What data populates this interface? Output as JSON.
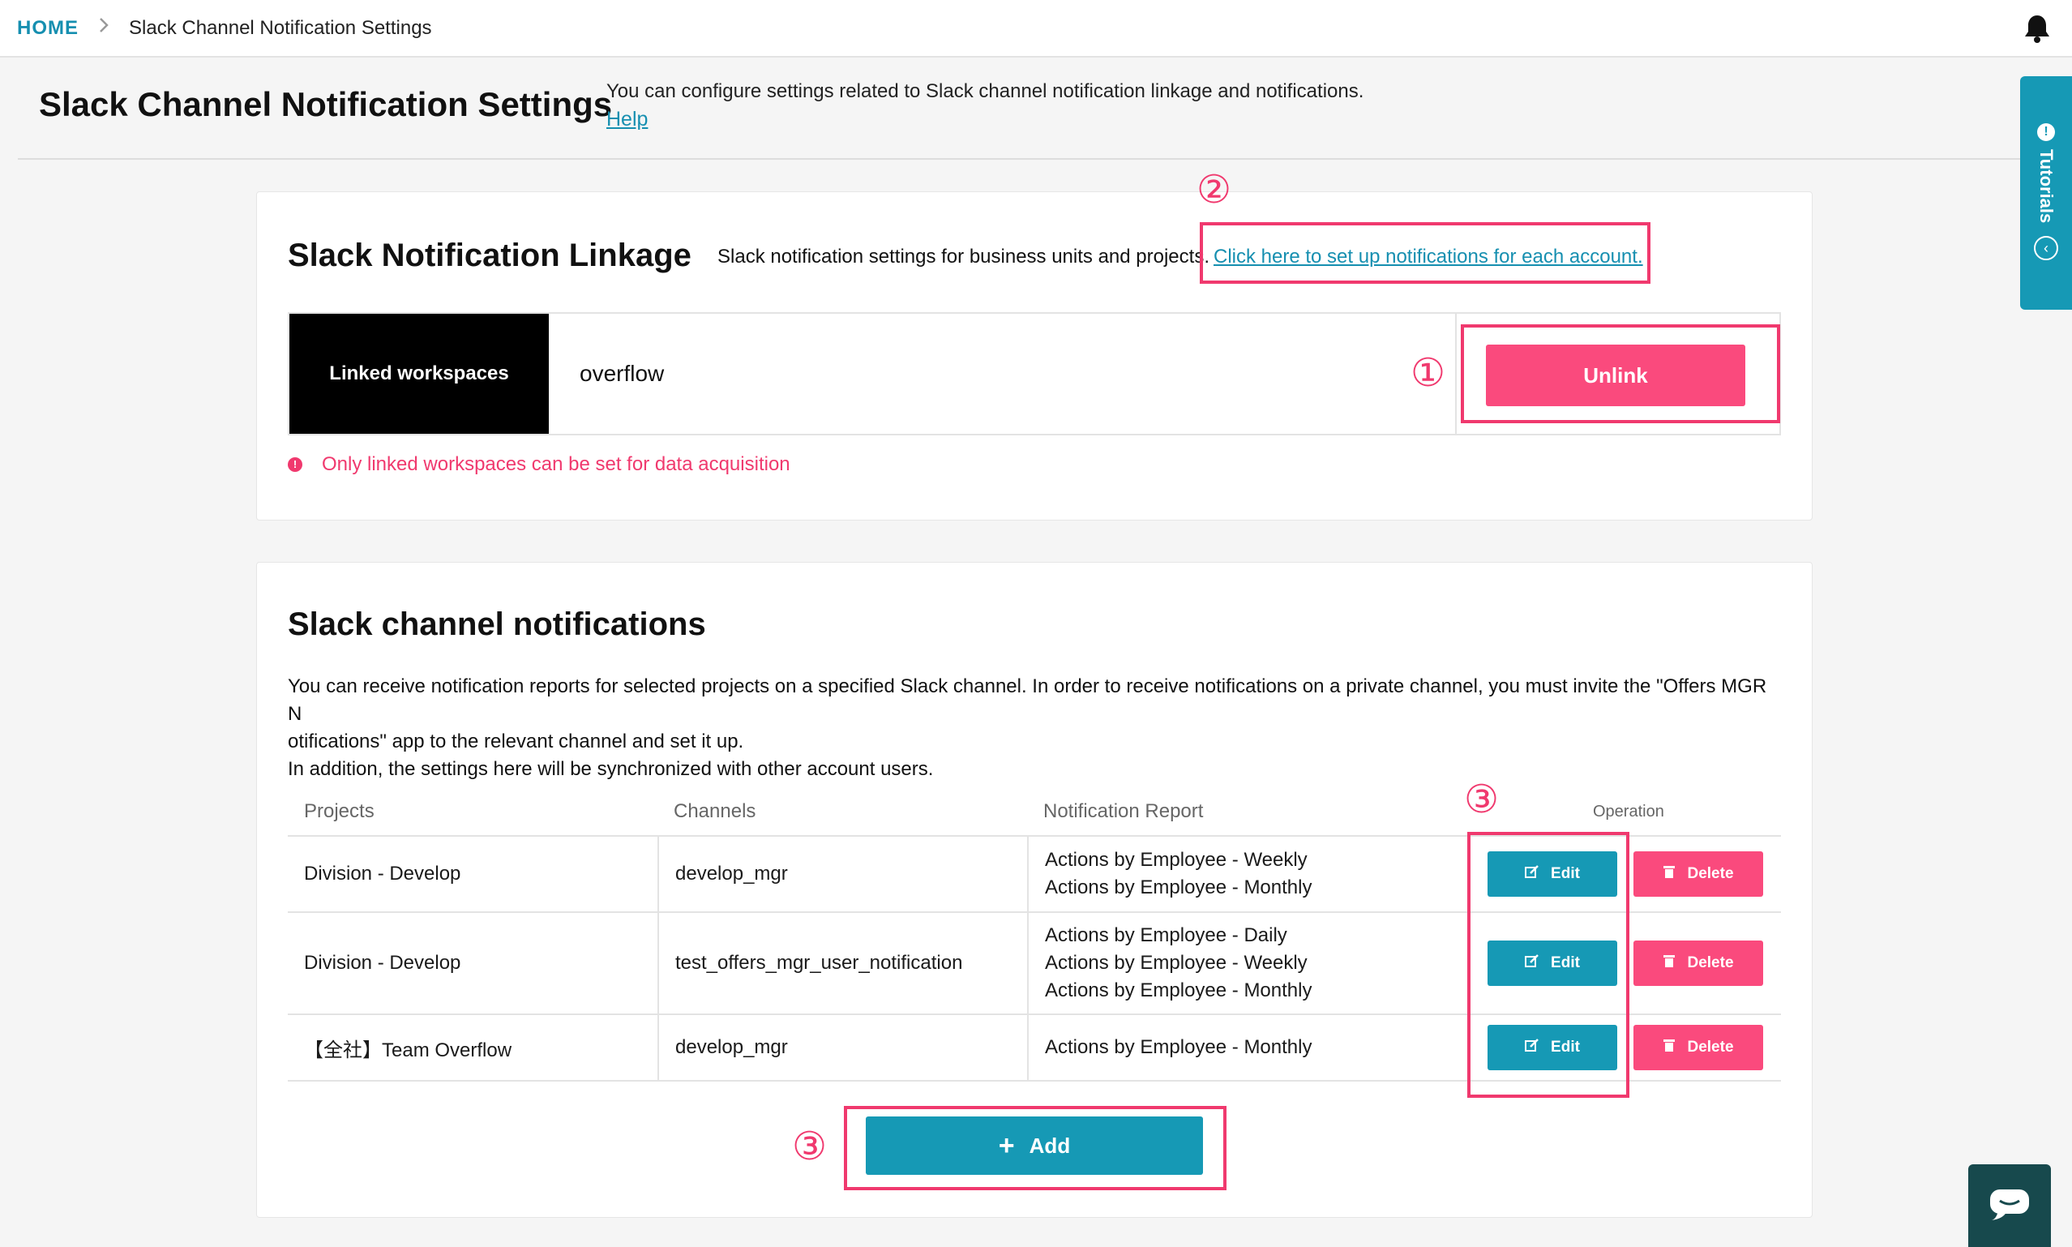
{
  "breadcrumb": {
    "home": "HOME",
    "separator": ">",
    "current": "Slack Channel Notification Settings"
  },
  "header": {
    "title": "Slack Channel Notification Settings",
    "description": "You can configure settings related to Slack channel notification linkage and notifications.",
    "help": "Help"
  },
  "tutorials": {
    "label": "Tutorials"
  },
  "linkage": {
    "title": "Slack Notification Linkage",
    "description": "Slack notification settings for business units and projects.",
    "account_link": "Click here to set up notifications for each account.",
    "workspace_label": "Linked workspaces",
    "workspace_value": "overflow",
    "unlink": "Unlink",
    "note": "Only linked workspaces can be set for data acquisition"
  },
  "channels": {
    "title": "Slack channel notifications",
    "description_line1": "You can receive notification reports for selected projects on a specified Slack channel. In order to receive notifications on a private channel, you must invite the \"Offers MGR N",
    "description_line2": "otifications\" app to the relevant channel and set it up.",
    "description_line3": "In addition, the settings here will be synchronized with other account users.",
    "columns": {
      "projects": "Projects",
      "channels": "Channels",
      "report": "Notification Report",
      "operation": "Operation"
    },
    "rows": [
      {
        "project": "Division - Develop",
        "channel": "develop_mgr",
        "reports": [
          "Actions by Employee - Weekly",
          "Actions by Employee - Monthly"
        ]
      },
      {
        "project": "Division - Develop",
        "channel": "test_offers_mgr_user_notification",
        "reports": [
          "Actions by Employee - Daily",
          "Actions by Employee - Weekly",
          "Actions by Employee - Monthly"
        ]
      },
      {
        "project": "【全社】Team Overflow",
        "channel": "develop_mgr",
        "reports": [
          "Actions by Employee - Monthly"
        ]
      }
    ],
    "edit": "Edit",
    "delete": "Delete",
    "add": "Add"
  },
  "annotations": {
    "one": "①",
    "two": "②",
    "three": "③"
  },
  "colors": {
    "accent": "#1699b5",
    "danger": "#fa4a7d",
    "annotation": "#f0396e"
  }
}
